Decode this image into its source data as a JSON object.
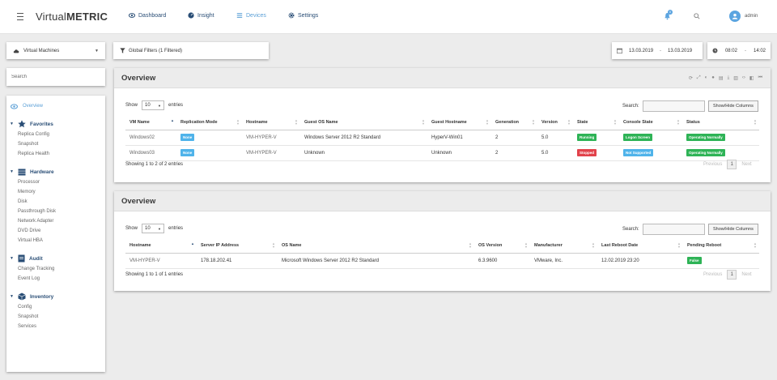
{
  "header": {
    "logo_light": "Virtual",
    "logo_bold": "METRIC",
    "nav": [
      {
        "label": "Dashboard",
        "icon": "eye-icon"
      },
      {
        "label": "Insight",
        "icon": "gauge-icon"
      },
      {
        "label": "Devices",
        "icon": "list-icon"
      },
      {
        "label": "Settings",
        "icon": "gear-icon"
      }
    ],
    "notification_count": "0",
    "user": "admin"
  },
  "filters": {
    "source": "Virtual Machines",
    "global_filters": "Global Filters (1 Filtered)",
    "date_from": "13.03.2019",
    "date_to": "13.03.2019",
    "date_sep": "-",
    "time_from": "08:02",
    "time_to": "14:02",
    "time_sep": "-"
  },
  "sidebar": {
    "search_placeholder": "Search",
    "overview": "Overview",
    "groups": [
      {
        "title": "Favorites",
        "items": [
          "Replica Config",
          "Snapshot",
          "Replica Health"
        ]
      },
      {
        "title": "Hardware",
        "items": [
          "Processor",
          "Memory",
          "Disk",
          "Passthrough Disk",
          "Network Adapter",
          "DVD Drive",
          "Virtual HBA"
        ]
      },
      {
        "title": "Audit",
        "items": [
          "Change Tracking",
          "Event Log"
        ]
      },
      {
        "title": "Inventory",
        "items": [
          "Config",
          "Snapshot",
          "Services"
        ]
      }
    ]
  },
  "panel1": {
    "title": "Overview",
    "show": "Show",
    "length": "10",
    "entries": "entries",
    "search_label": "Search:",
    "columns_button": "Show/Hide Columns",
    "headers": [
      "VM Name",
      "Replication Mode",
      "Hostname",
      "Guest OS Name",
      "Guest Hostname",
      "Generation",
      "Version",
      "State",
      "Console State",
      "Status"
    ],
    "rows": [
      [
        "Windows02",
        "None",
        "VM-HYPER-V",
        "Windows Server 2012 R2 Standard",
        "HyperV-Win01",
        "2",
        "5.0",
        "Running",
        "Logon Screen",
        "Operating Normally"
      ],
      [
        "Windows03",
        "None",
        "VM-HYPER-V",
        "Unknown",
        "Unknown",
        "2",
        "5.0",
        "Stopped",
        "Not Supported",
        "Operating Normally"
      ]
    ],
    "info": "Showing 1 to 2 of 2 entries",
    "previous": "Previous",
    "page": "1",
    "next": "Next"
  },
  "panel2": {
    "title": "Overview",
    "show": "Show",
    "length": "10",
    "entries": "entries",
    "search_label": "Search:",
    "columns_button": "Show/Hide Columns",
    "headers": [
      "Hostname",
      "Server IP Address",
      "OS Name",
      "OS Version",
      "Manufacturer",
      "Last Reboot Date",
      "Pending Reboot"
    ],
    "rows": [
      [
        "VM-HYPER-V",
        "178.18.202.41",
        "Microsoft Windows Server 2012 R2 Standard",
        "6.3.9600",
        "VMware, Inc.",
        "12.02.2019 23:20",
        "False"
      ]
    ],
    "info": "Showing 1 to 1 of 1 entries",
    "previous": "Previous",
    "page": "1",
    "next": "Next"
  },
  "colors": {
    "accent": "#5a9fd6",
    "navy": "#2a4e76",
    "badge_blue": "#4fb3ea",
    "badge_green": "#2eb356",
    "badge_red": "#e2424b"
  }
}
